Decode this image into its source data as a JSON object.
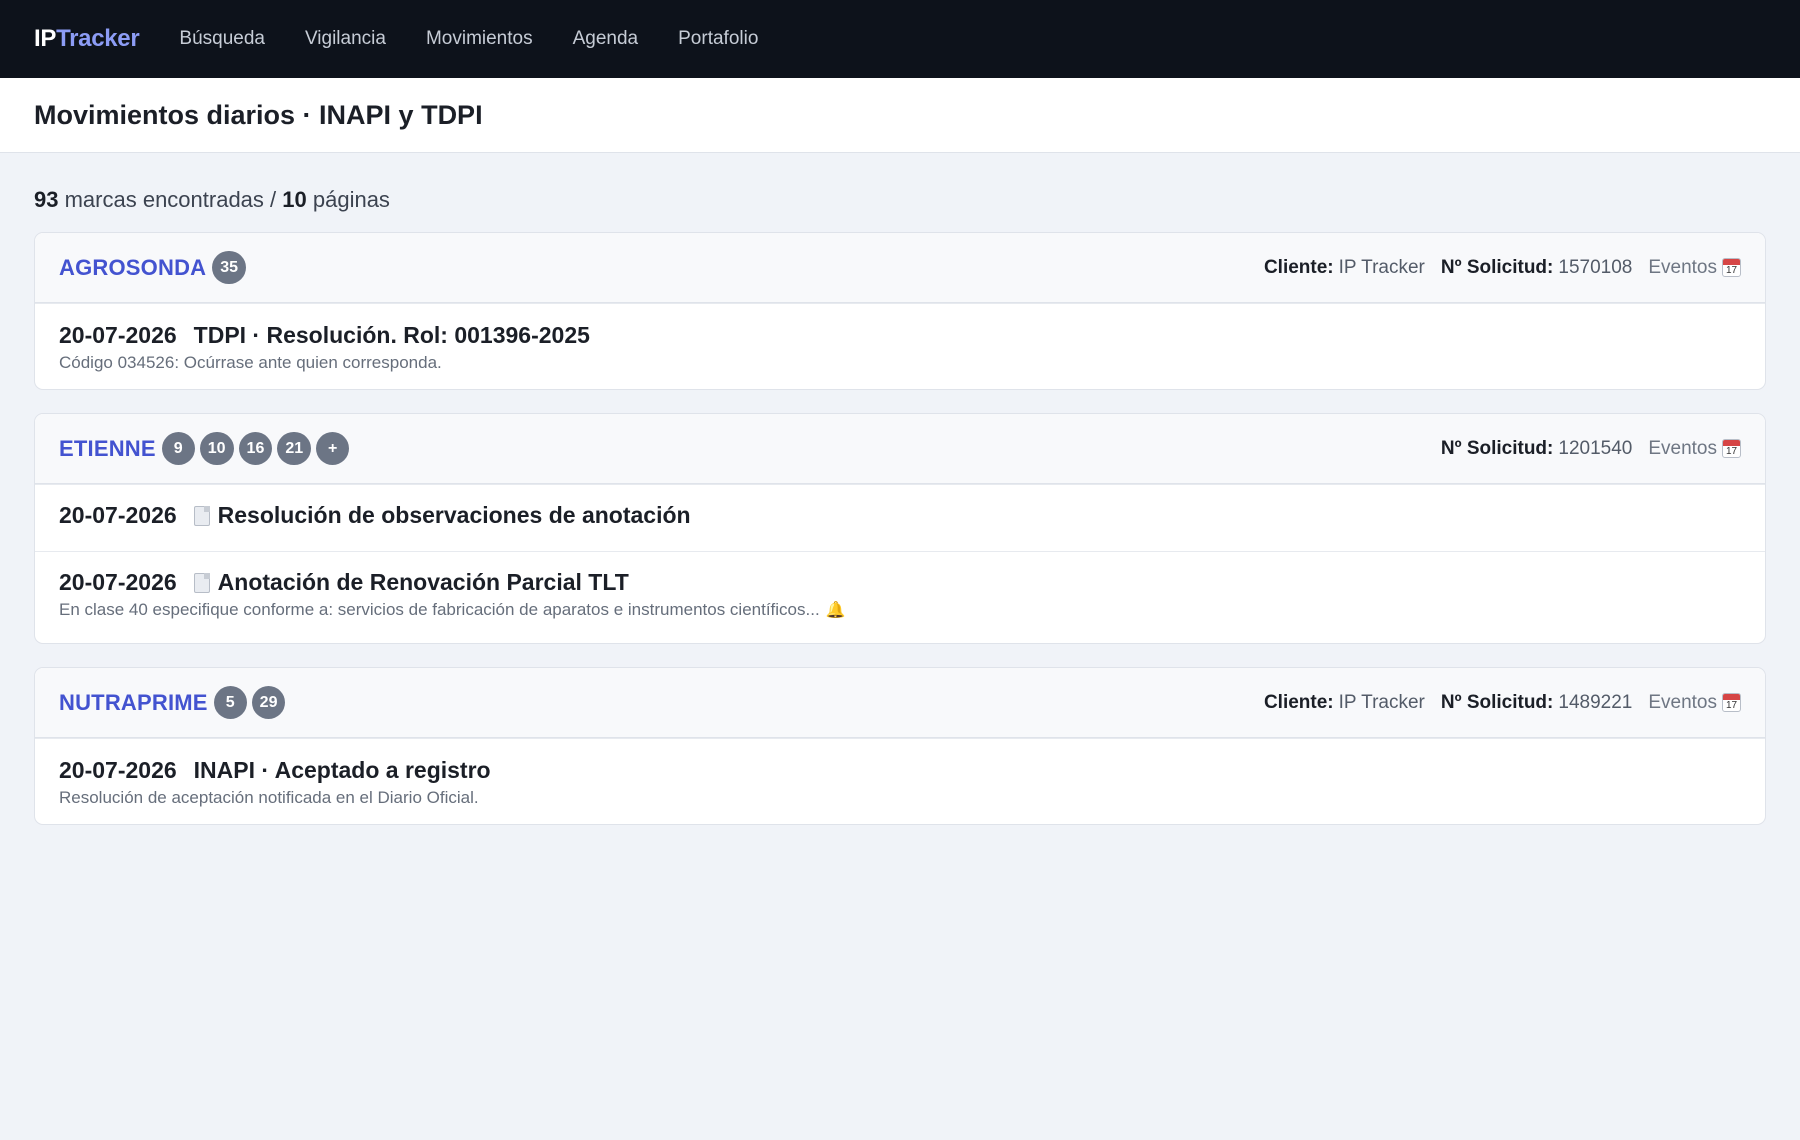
{
  "nav": {
    "brand_a": "IP",
    "brand_b": "Tracker",
    "links": [
      "Búsqueda",
      "Vigilancia",
      "Movimientos",
      "Agenda",
      "Portafolio"
    ]
  },
  "page": {
    "title": "Movimientos diarios · INAPI y TDPI"
  },
  "summary": {
    "count": "93",
    "count_text": " marcas encontradas / ",
    "pages": "10",
    "pages_text": " páginas"
  },
  "labels": {
    "cliente": "Cliente:",
    "solicitud": "Nº Solicitud:",
    "eventos": "Eventos"
  },
  "cards": [
    {
      "name": "AGROSONDA",
      "badges": [
        "35"
      ],
      "cliente": "IP Tracker",
      "solicitud": "1570108",
      "entries": [
        {
          "date": "20-07-2026",
          "title": "TDPI · Resolución. Rol: 001396-2025",
          "desc": "Código 034526: Ocúrrase ante quien corresponda."
        }
      ]
    },
    {
      "name": "ETIENNE",
      "badges": [
        "9",
        "10",
        "16",
        "21",
        "+"
      ],
      "solicitud": "1201540",
      "entries": [
        {
          "date": "20-07-2026",
          "title": "Resolución de observaciones de anotación"
        },
        {
          "date": "20-07-2026",
          "title": "Anotación de Renovación Parcial TLT",
          "desc": "En clase 40 especifique conforme a: servicios de fabricación de aparatos e instrumentos científicos..."
        }
      ]
    },
    {
      "name": "NUTRAPRIME",
      "badges": [
        "5",
        "29"
      ],
      "cliente": "IP Tracker",
      "solicitud": "1489221",
      "entries": [
        {
          "date": "20-07-2026",
          "title": "INAPI · Aceptado a registro",
          "desc": "Resolución de aceptación notificada en el Diario Oficial."
        }
      ]
    }
  ],
  "icons": {
    "calendar": "calendar-icon",
    "document": "document-icon",
    "bell": "bell-icon"
  },
  "colors": {
    "nav_bg": "#0d121b",
    "brand_accent": "#8c9cf5",
    "mark_link": "#4353d0",
    "badge_bg": "#6c7585",
    "page_bg": "#f0f3f8"
  }
}
